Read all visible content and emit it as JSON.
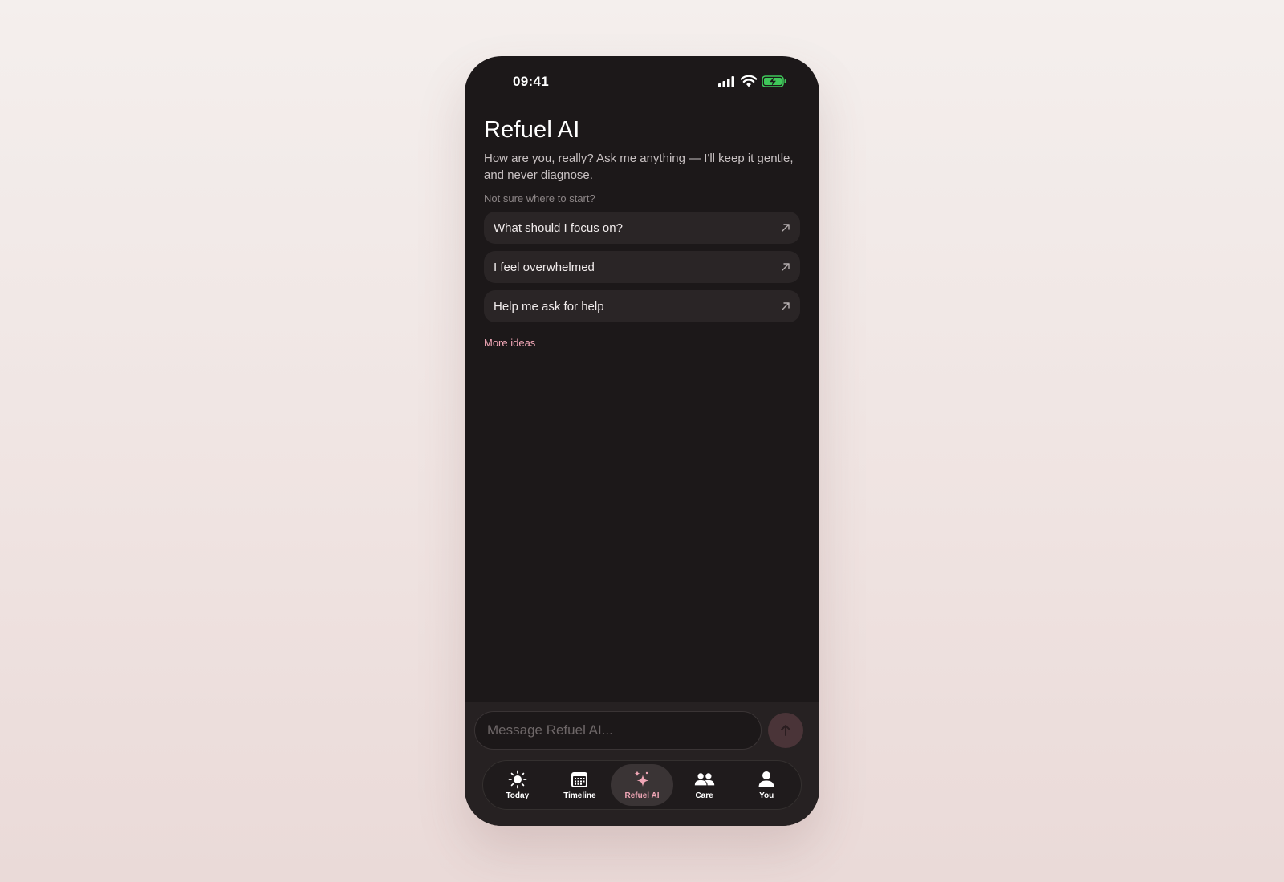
{
  "status_bar": {
    "time": "09:41"
  },
  "header": {
    "title": "Refuel AI",
    "subtitle": "How are you, really? Ask me anything — I'll keep it gentle, and never diagnose."
  },
  "prompts": {
    "label": "Not sure where to start?",
    "items": [
      {
        "label": "What should I focus on?"
      },
      {
        "label": "I feel overwhelmed"
      },
      {
        "label": "Help me ask for help"
      }
    ],
    "more_label": "More ideas"
  },
  "composer": {
    "placeholder": "Message Refuel AI..."
  },
  "tabbar": {
    "items": [
      {
        "label": "Today",
        "icon": "sun-icon"
      },
      {
        "label": "Timeline",
        "icon": "calendar-icon"
      },
      {
        "label": "Refuel AI",
        "icon": "sparkle-icon",
        "active": true
      },
      {
        "label": "Care",
        "icon": "people-icon"
      },
      {
        "label": "You",
        "icon": "person-icon"
      }
    ]
  },
  "colors": {
    "accent": "#f0a6b6",
    "background": "#1c1819",
    "battery": "#3fc85a"
  }
}
